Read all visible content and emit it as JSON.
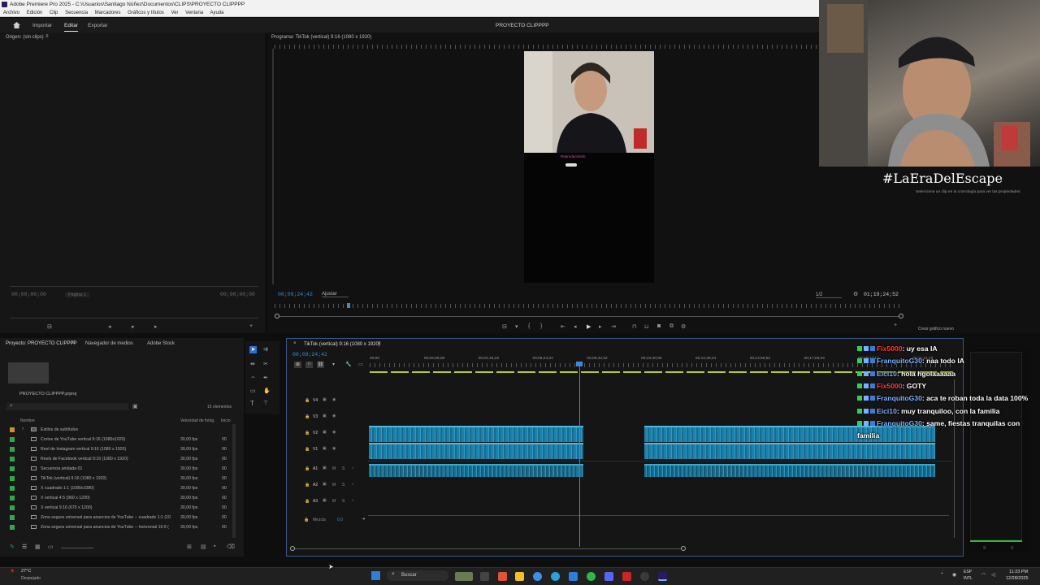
{
  "window": {
    "title": "Adobe Premiere Pro 2025 - C:\\Usuarios\\Santiago Núñez\\Documentos\\CLIPS\\PROYECTO CLIPPPP"
  },
  "menu": [
    "Archivo",
    "Edición",
    "Clip",
    "Secuencia",
    "Marcadores",
    "Gráficos y títulos",
    "Ver",
    "Ventana",
    "Ayuda"
  ],
  "header": {
    "home_icon": "home-icon",
    "tabs": [
      "Importar",
      "Editar",
      "Exportar"
    ],
    "active_tab": "Editar",
    "project_title": "PROYECTO CLIPPPP"
  },
  "source": {
    "title": "Origen: (sin clips)",
    "timecode_left": "00;00;00;00",
    "page": "Página 1",
    "timecode_right": "00;00;00;00"
  },
  "program": {
    "title": "Programa: TikTok (vertical) 9:16 (1080 x 1920)",
    "timecode": "00;09;24;42",
    "fit": "Ajustar",
    "resolution": "1/2",
    "duration": "01;19;24;52",
    "video_caption": "Reproduciendo"
  },
  "properties": {
    "hint": "Seleccione un clip en la cronología para ver las propiedades.",
    "create_button": "Crear gráfico nuevo"
  },
  "project": {
    "tabs": [
      "Proyecto: PROYECTO CLIPPPP",
      "Navegador de medios",
      "Adobe Stock"
    ],
    "file": "PROYECTO CLIPPPP.prproj",
    "count": "15 elementos",
    "columns": [
      "Nombre",
      "Velocidad de fotog.",
      "Inicio"
    ],
    "items": [
      {
        "name": "Estilos de subtítulos",
        "fps": "",
        "z": "",
        "color": "#d88a2c",
        "folder": true
      },
      {
        "name": "Cortos de YouTube vertical 9:16 (1080x1920)",
        "fps": "30,00 fps",
        "z": "00",
        "color": "#2fa84a",
        "folder": false
      },
      {
        "name": "Reel de Instagram vertical 9:16 (1080 x 1920)",
        "fps": "30,00 fps",
        "z": "00",
        "color": "#2fa84a",
        "folder": false
      },
      {
        "name": "Reels de Facebook vertical 9:16 (1080 x 1920)",
        "fps": "30,00 fps",
        "z": "00",
        "color": "#2fa84a",
        "folder": false
      },
      {
        "name": "Secuencia anidada 01",
        "fps": "30,00 fps",
        "z": "00",
        "color": "#2fa84a",
        "folder": false
      },
      {
        "name": "TikTok (vertical) 9:16 (1080 x 1920)",
        "fps": "30,00 fps",
        "z": "00",
        "color": "#2fa84a",
        "folder": false
      },
      {
        "name": "X cuadrado 1:1 (1080x1080)",
        "fps": "30,00 fps",
        "z": "00",
        "color": "#2fa84a",
        "folder": false
      },
      {
        "name": "X vertical 4:5 (960 x 1200)",
        "fps": "30,00 fps",
        "z": "00",
        "color": "#2fa84a",
        "folder": false
      },
      {
        "name": "X vertical 9:16 (675 x 1200)",
        "fps": "30,00 fps",
        "z": "00",
        "color": "#2fa84a",
        "folder": false
      },
      {
        "name": "Zona segura universal para anuncios de YouTube -- cuadrado 1:1 (10",
        "fps": "30,00 fps",
        "z": "00",
        "color": "#2fa84a",
        "folder": false
      },
      {
        "name": "Zona segura universal para anuncios de YouTube -- horizontal 16:9 (",
        "fps": "30,00 fps",
        "z": "00",
        "color": "#2fa84a",
        "folder": false
      }
    ]
  },
  "timeline": {
    "title": "TikTok (vertical) 9:16 (1080 x 1920)",
    "timecode": "00;09;24;42",
    "ruler_labels": [
      "00;00",
      "00;02;08;08",
      "00;04;16;16",
      "00;06;24;24",
      "00;08;32;32",
      "00;10;40;38",
      "00;12;48;44",
      "00;14;56;52",
      "00;17;05;04",
      "00;19;13;12",
      "00;21;21;16"
    ],
    "video_tracks": [
      "V4",
      "V3",
      "V2",
      "V1"
    ],
    "audio_tracks": [
      "A1",
      "A2",
      "A3"
    ],
    "mix_label": "Mezcla",
    "mix_value": "0,0"
  },
  "chat": [
    {
      "user": "Fix5000",
      "msg": ": uy esa IA",
      "color": "#ff3b3b"
    },
    {
      "user": "FranquitoG30",
      "msg": ": naa todo IA",
      "color": "#7fb2ff"
    },
    {
      "user": "Eici10",
      "msg": ": hola hgolaaaaaa",
      "color": "#7fb2ff"
    },
    {
      "user": "Fix5000",
      "msg": ": GOTY",
      "color": "#ff3b3b"
    },
    {
      "user": "FranquitoG30",
      "msg": ": aca te roban toda la data 100%",
      "color": "#7fb2ff"
    },
    {
      "user": "Eici10",
      "msg": ": muy tranquiloo, con la familia",
      "color": "#7fb2ff"
    },
    {
      "user": "FranquitoG30",
      "msg": ": same, fiestas tranquilas con",
      "color": "#7fb2ff"
    },
    {
      "user": "",
      "msg": "familia",
      "color": "#ffffff"
    }
  ],
  "overlay": {
    "hashtag": "#LaEraDelEscape"
  },
  "taskbar": {
    "weather_temp": "27°C",
    "weather_desc": "Despejado",
    "search": "Buscar",
    "lang": "ESP",
    "lang2": "INTL",
    "time": "11:23 PM",
    "date": "12/28/2025"
  }
}
